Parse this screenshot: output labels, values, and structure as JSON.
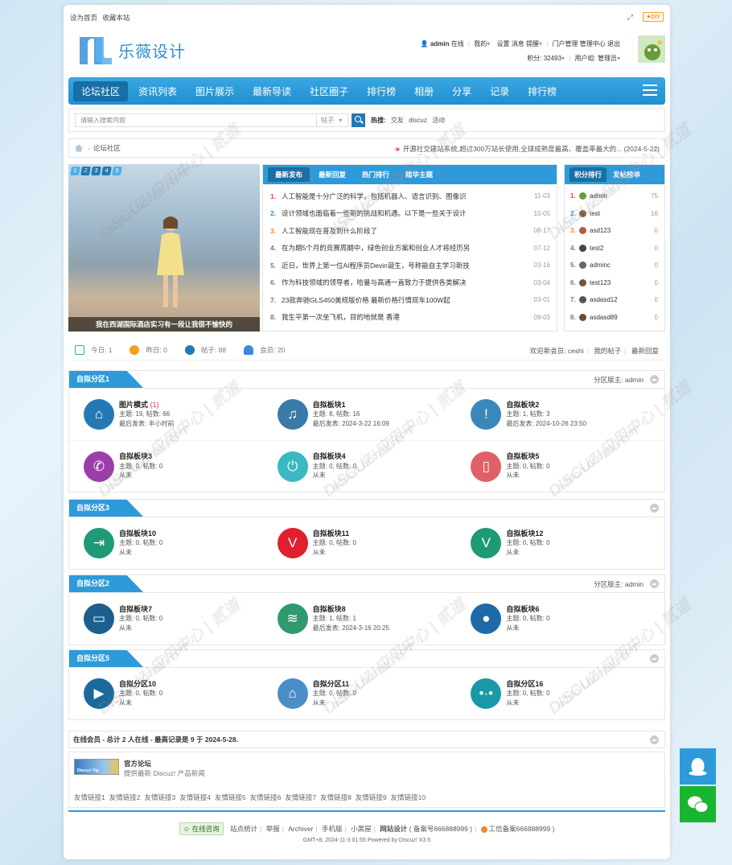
{
  "topbar": {
    "set_home": "设为首页",
    "bookmark": "收藏本站",
    "diy": "DIY"
  },
  "logo": {
    "name": "乐薇设计"
  },
  "user": {
    "line1": [
      "admin",
      "在线",
      "|",
      "我的",
      "设置",
      "消息",
      "提醒",
      "|",
      "门户管理",
      "管理中心",
      "退出"
    ],
    "credits": "积分: 32493",
    "group": "用户组: 管理员"
  },
  "nav": {
    "items": [
      "论坛社区",
      "资讯列表",
      "图片展示",
      "最新导读",
      "社区圈子",
      "排行榜",
      "相册",
      "分享",
      "记录",
      "排行榜"
    ],
    "active": 0
  },
  "search": {
    "placeholder": "请输入搜索内容",
    "type": "帖子",
    "hot_label": "热搜:",
    "hot": [
      "交友",
      "discuz",
      "活动"
    ]
  },
  "breadcrumb": {
    "home": "论坛社区",
    "announcement": "开源社交建站系统,超过300万站长使用,全球成熟度最高、覆盖率最大的... (2024-5-22)"
  },
  "slide": {
    "pages": [
      "1",
      "2",
      "3",
      "4",
      "5"
    ],
    "caption": "我在西湖国际酒店实习有一段让我很不愉快的"
  },
  "posts": {
    "tabs": [
      "最新发布",
      "最新回复",
      "热门排行",
      "精华主题"
    ],
    "items": [
      {
        "n": "1.",
        "t": "人工智能是十分广泛的科学，包括机器人、语言识别、图像识",
        "d": "11-03"
      },
      {
        "n": "2.",
        "t": "设计领域也面临着一些新的挑战和机遇。以下是一些关于设计",
        "d": "10-05"
      },
      {
        "n": "3.",
        "t": "人工智能现在普及到什么阶段了",
        "d": "08-17"
      },
      {
        "n": "4.",
        "t": "在为期5个月的竞赛周期中，绿色创业方案和创业人才将经历另",
        "d": "07-12"
      },
      {
        "n": "5.",
        "t": "近日，世界上第一位AI程序员Devin诞生，号称能自主学习新技",
        "d": "03-16"
      },
      {
        "n": "6.",
        "t": "作为科技领域的领导者，哈曼与高通一直致力于提供各类解决",
        "d": "03-04"
      },
      {
        "n": "7.",
        "t": "23款奔驰GLS450美规版价格 最新价格行情现车100W起",
        "d": "03-01"
      },
      {
        "n": "8.",
        "t": "我生平第一次坐飞机，目的地就是 香港",
        "d": "09-03"
      }
    ]
  },
  "rank": {
    "tabs": [
      "积分排行",
      "发帖榜单"
    ],
    "items": [
      {
        "n": "1.",
        "u": "admin",
        "v": "75"
      },
      {
        "n": "2.",
        "u": "test",
        "v": "16"
      },
      {
        "n": "3.",
        "u": "asd123",
        "v": "0"
      },
      {
        "n": "4.",
        "u": "test2",
        "v": "0"
      },
      {
        "n": "5.",
        "u": "adminc",
        "v": "0"
      },
      {
        "n": "6.",
        "u": "test123",
        "v": "0"
      },
      {
        "n": "7.",
        "u": "asdasd12",
        "v": "0"
      },
      {
        "n": "8.",
        "u": "asdasd89",
        "v": "0"
      }
    ]
  },
  "stats": {
    "today": "今日: 1",
    "yesterday": "昨日: 0",
    "posts": "帖子: 88",
    "members": "会员: 20",
    "welcome": "欢迎新会员: ceshi",
    "my_posts": "我的帖子",
    "latest_reply": "最新回复"
  },
  "groups": [
    {
      "title": "自拟分区1",
      "mod": "分区版主: admin",
      "forums": [
        {
          "name": "图片模式",
          "new": "(1)",
          "stat": "主题: 19, 帖数: 66",
          "last": "最后发表: 半小时前",
          "color": "#2479b4",
          "icon": "home-icon",
          "glyph": "⌂"
        },
        {
          "name": "自拟板块1",
          "stat": "主题: 8, 帖数: 16",
          "last": "最后发表: 2024-3-22 16:09",
          "color": "#3a7aa8",
          "icon": "music-icon",
          "glyph": "♫"
        },
        {
          "name": "自拟板块2",
          "stat": "主题: 1, 帖数: 3",
          "last": "最后发表: 2024-10-26 23:50",
          "color": "#3a88bb",
          "icon": "alert-icon",
          "glyph": "!"
        },
        {
          "name": "自拟板块3",
          "stat": "主题: 0, 帖数: 0",
          "last": "从未",
          "color": "#9b3fa8",
          "icon": "phone-icon",
          "glyph": "✆"
        },
        {
          "name": "自拟板块4",
          "stat": "主题: 0, 帖数: 0",
          "last": "从未",
          "color": "#3ab8c4",
          "icon": "power-icon",
          "glyph": "⏻"
        },
        {
          "name": "自拟板块5",
          "stat": "主题: 0, 帖数: 0",
          "last": "从未",
          "color": "#e0606a",
          "icon": "mobile-icon",
          "glyph": "▯"
        }
      ]
    },
    {
      "title": "自拟分区3",
      "mod": "",
      "forums": [
        {
          "name": "自拟板块10",
          "stat": "主题: 0, 帖数: 0",
          "last": "从未",
          "color": "#1f9a78",
          "icon": "signin-icon",
          "glyph": "⇥"
        },
        {
          "name": "自拟板块11",
          "stat": "主题: 0, 帖数: 0",
          "last": "从未",
          "color": "#e0202e",
          "icon": "vimeo-icon",
          "glyph": "V"
        },
        {
          "name": "自拟板块12",
          "stat": "主题: 0, 帖数: 0",
          "last": "从未",
          "color": "#1e9a76",
          "icon": "vine-icon",
          "glyph": "V"
        }
      ]
    },
    {
      "title": "自拟分区2",
      "mod": "分区版主: admin",
      "forums": [
        {
          "name": "自拟板块7",
          "stat": "主题: 0, 帖数: 0",
          "last": "从未",
          "color": "#1c5f8e",
          "icon": "folder-icon",
          "glyph": "▭"
        },
        {
          "name": "自拟板块8",
          "stat": "主题: 1, 帖数: 1",
          "last": "最后发表: 2024-3-16 20:25",
          "color": "#2f9a70",
          "icon": "wifi-icon",
          "glyph": "≋"
        },
        {
          "name": "自拟板块6",
          "stat": "主题: 0, 帖数: 0",
          "last": "从未",
          "color": "#1e6aa8",
          "icon": "mic-icon",
          "glyph": "●"
        }
      ]
    },
    {
      "title": "自拟分区5",
      "mod": "",
      "forums": [
        {
          "name": "自拟分区10",
          "stat": "主题: 0, 帖数: 0",
          "last": "从未",
          "color": "#1c6a9c",
          "icon": "play-icon",
          "glyph": "▶"
        },
        {
          "name": "自拟分区11",
          "stat": "主题: 0, 帖数: 0",
          "last": "从未",
          "color": "#4a8ec8",
          "icon": "house-icon",
          "glyph": "⌂"
        },
        {
          "name": "自拟分区16",
          "stat": "主题: 0, 帖数: 0",
          "last": "从未",
          "color": "#1898a8",
          "icon": "chat-icon",
          "glyph": "•·•"
        }
      ]
    }
  ],
  "online": {
    "text": "在线会员 - 总计 2 人在线 - 最高记录是 9 于 2024-5-28."
  },
  "links": {
    "logo_text": "Discuz! Vip",
    "name": "官方论坛",
    "desc": "提供最新 Discuz! 产品新闻",
    "friends": [
      "友情链接1",
      "友情链接2",
      "友情链接3",
      "友情链接4",
      "友情链接5",
      "友情链接6",
      "友情链接7",
      "友情链接8",
      "友情链接9",
      "友情链接10"
    ]
  },
  "footer": {
    "consult": "在线咨询",
    "items": [
      "站点统计",
      "举报",
      "Archiver",
      "手机版",
      "小黑屋"
    ],
    "site": "网站设计",
    "icp": "( 备案号666888999 )",
    "gongan": "工信备案666888999 )",
    "copy": "GMT+8, 2024-11-3 01:55 Powered by Discuz! X3.5"
  },
  "watermark": {
    "text": "DISCUZ!应用中心 | 贰道",
    "url": "addon.dismall.com"
  }
}
